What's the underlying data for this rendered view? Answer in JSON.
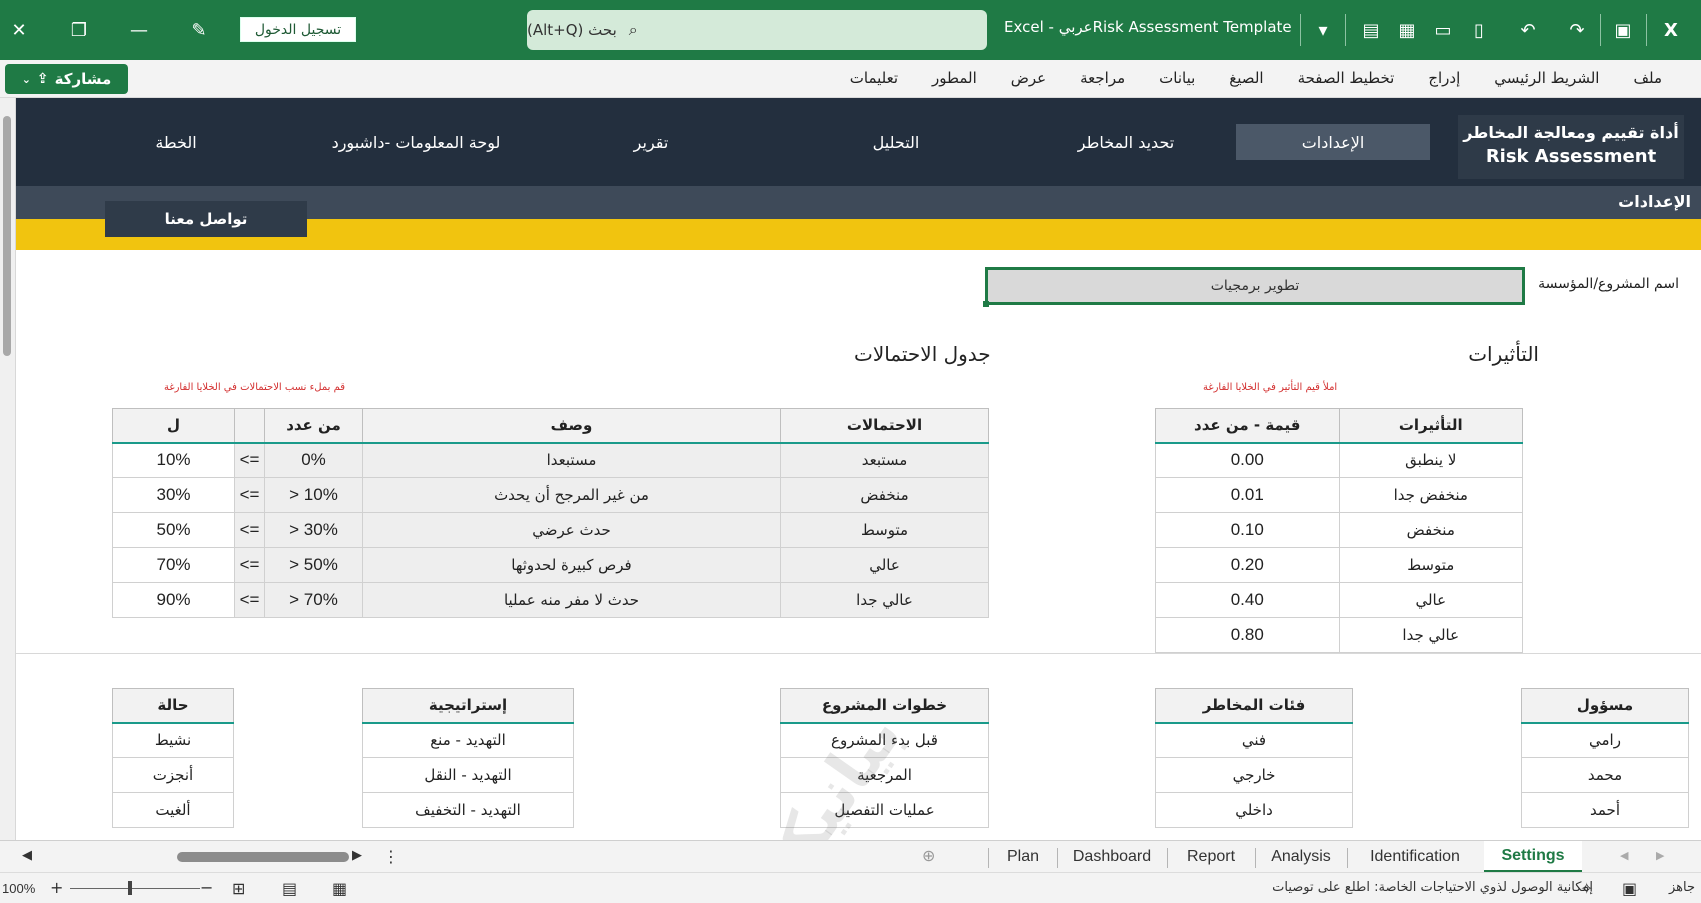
{
  "titlebar": {
    "signin": "تسجيل الدخول",
    "search_placeholder": "بحث (Alt+Q)",
    "app_title": "Excel  -  عربيRisk Assessment Template"
  },
  "menu": {
    "share": "مشاركة",
    "items": [
      "ملف",
      "الشريط الرئيسي",
      "إدراج",
      "تخطيط الصفحة",
      "الصيغ",
      "بيانات",
      "مراجعة",
      "عرض",
      "المطور",
      "تعليمات"
    ]
  },
  "nav": {
    "logo_line1": "أداة تقييم ومعالجة المخاطر",
    "logo_line2": "Risk Assessment",
    "items": [
      "الإعدادات",
      "تحديد المخاطر",
      "التحليل",
      "تقرير",
      "لوحة المعلومات -داشبورد",
      "الخطة"
    ]
  },
  "subheader": {
    "title": "الإعدادات",
    "contact": "تواصل معنا"
  },
  "project": {
    "label": "اسم المشروع/المؤسسة",
    "value": "تطوير برمجيات"
  },
  "impacts": {
    "title": "التأثيرات",
    "hint": "املأ قيم التأثير في الخلايا الفارغة",
    "headers": [
      "التأثيرات",
      "قيمة - من عدد"
    ],
    "rows": [
      [
        "لا ينطبق",
        "0.00"
      ],
      [
        "منخفض جدا",
        "0.01"
      ],
      [
        "منخفض",
        "0.10"
      ],
      [
        "متوسط",
        "0.20"
      ],
      [
        "عالي",
        "0.40"
      ],
      [
        "عالي جدا",
        "0.80"
      ]
    ]
  },
  "probabilities": {
    "title": "جدول الاحتمالات",
    "hint": "قم بملء نسب الاحتمالات في الخلايا الفارغة",
    "headers": [
      "الاحتمالات",
      "وصف",
      "من عدد",
      "",
      "ل"
    ],
    "rows": [
      [
        "مستبعد",
        "مستبعدا",
        "0%",
        "<=",
        "10%"
      ],
      [
        "منخفض",
        "من غير المرجح أن يحدث",
        "> 10%",
        "<=",
        "30%"
      ],
      [
        "متوسط",
        "حدث عرضي",
        "> 30%",
        "<=",
        "50%"
      ],
      [
        "عالي",
        "فرص كبيرة لحدوثها",
        "> 50%",
        "<=",
        "70%"
      ],
      [
        "عالي جدا",
        "حدث لا مفر منه عمليا",
        "> 70%",
        "<=",
        "90%"
      ]
    ]
  },
  "lists": {
    "owner": {
      "header": "مسؤول",
      "items": [
        "رامي",
        "محمد",
        "أحمد"
      ]
    },
    "categories": {
      "header": "فئات المخاطر",
      "items": [
        "فني",
        "خارجي",
        "داخلي"
      ]
    },
    "steps": {
      "header": "خطوات المشروع",
      "items": [
        "قبل بدء المشروع",
        "المرجعية",
        "عمليات التفصيل"
      ]
    },
    "strategy": {
      "header": "إستراتيجية",
      "items": [
        "التهديد - منع",
        "التهديد - النقل",
        "التهديد - التخفيف"
      ]
    },
    "status": {
      "header": "حالة",
      "items": [
        "نشيط",
        "أنجزت",
        "ألغيت"
      ]
    }
  },
  "tabs": [
    "Plan",
    "Dashboard",
    "Report",
    "Analysis",
    "Identification",
    "Settings"
  ],
  "active_tab": "Settings",
  "status": {
    "ready": "جاهز",
    "accessibility": "إمكانية الوصول لذوي الاحتياجات الخاصة: اطلع على توصيات",
    "zoom": "100%"
  },
  "watermark": "بيانيكا",
  "colors": {
    "excel_green": "#1f7a45",
    "nav_dark": "#232f3e",
    "yellow": "#f1c40f",
    "teal_rule": "#1a9a8a",
    "hint_red": "#d32f2f"
  },
  "icons": [
    "close-icon",
    "minimize-icon",
    "restore-icon",
    "pen-icon",
    "search-icon",
    "dropdown-icon",
    "save-icon",
    "excel-icon",
    "share-icon",
    "undo-icon",
    "redo-icon",
    "new-file-icon",
    "open-file-icon"
  ]
}
